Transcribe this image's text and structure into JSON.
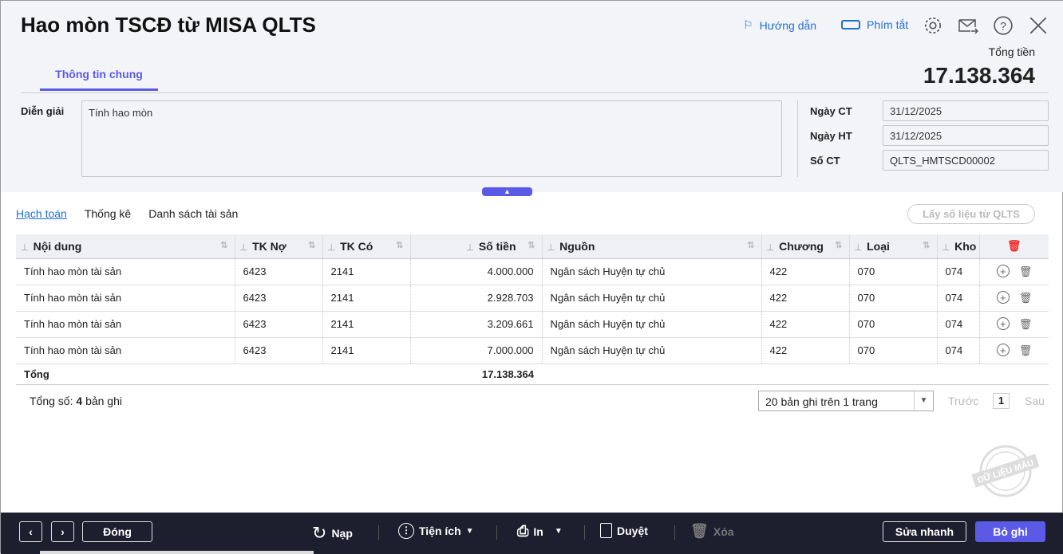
{
  "header": {
    "title": "Hao mòn TSCĐ từ MISA QLTS",
    "guide": "Hướng dẫn",
    "shortcuts": "Phím tắt",
    "total_label": "Tổng tiền",
    "total_value": "17.138.364",
    "tab": "Thông tin chung"
  },
  "form": {
    "desc_label": "Diễn giải",
    "desc_value": "Tính hao mòn",
    "date_ct_label": "Ngày CT",
    "date_ct": "31/12/2025",
    "date_ht_label": "Ngày HT",
    "date_ht": "31/12/2025",
    "so_ct_label": "Số CT",
    "so_ct": "QLTS_HMTSCD00002"
  },
  "subtabs": [
    "Hạch toán",
    "Thống kê",
    "Danh sách tài sản"
  ],
  "fetch_button": "Lấy số liệu từ QLTS",
  "table": {
    "columns": [
      "Nội dung",
      "TK Nợ",
      "TK Có",
      "Số tiền",
      "Nguồn",
      "Chương",
      "Loại",
      "Kho"
    ],
    "rows": [
      [
        "Tính hao mòn tài sản",
        "6423",
        "2141",
        "4.000.000",
        "Ngân sách Huyện tự chủ",
        "422",
        "070",
        "074"
      ],
      [
        "Tính hao mòn tài sản",
        "6423",
        "2141",
        "2.928.703",
        "Ngân sách Huyện tự chủ",
        "422",
        "070",
        "074"
      ],
      [
        "Tính hao mòn tài sản",
        "6423",
        "2141",
        "3.209.661",
        "Ngân sách Huyện tự chủ",
        "422",
        "070",
        "074"
      ],
      [
        "Tính hao mòn tài sản",
        "6423",
        "2141",
        "7.000.000",
        "Ngân sách Huyện tự chủ",
        "422",
        "070",
        "074"
      ]
    ],
    "total_label": "Tổng",
    "total_value": "17.138.364"
  },
  "paging": {
    "count_prefix": "Tổng số:",
    "count": "4",
    "count_suffix": "bản ghi",
    "page_size": "20 bản ghi trên 1 trang",
    "prev": "Trước",
    "page": "1",
    "next": "Sau"
  },
  "stamp": "DỮ LIỆU MẪU",
  "bottom": {
    "close": "Đóng",
    "reload": "Nạp",
    "utilities": "Tiện ích",
    "print": "In",
    "approve": "Duyệt",
    "delete": "Xóa",
    "quick_edit": "Sửa nhanh",
    "save": "Bỏ ghi"
  },
  "colors": {
    "accent": "#5a5ae6",
    "link": "#1f6fd1",
    "bar": "#1d1f2e"
  }
}
